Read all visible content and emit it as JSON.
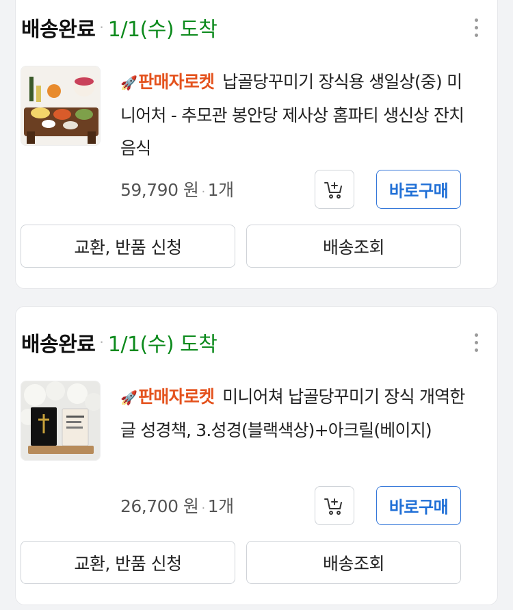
{
  "orders": [
    {
      "status": "배송완료",
      "arrival": "1/1(수) 도착",
      "badge": "판매자로켓",
      "title": "납골당꾸미기 장식용 생일상(중) 미니어처 - 추모관 봉안당 제사상 홈파티 생신상 잔치음식",
      "price": "59,790 원",
      "qty": "1개",
      "buy_label": "바로구매",
      "exchange_label": "교환, 반품 신청",
      "track_label": "배송조회"
    },
    {
      "status": "배송완료",
      "arrival": "1/1(수) 도착",
      "badge": "판매자로켓",
      "title": "미니어쳐 납골당꾸미기 장식 개역한글 성경책, 3.성경(블랙색상)+아크릴(베이지)",
      "price": "26,700 원",
      "qty": "1개",
      "buy_label": "바로구매",
      "exchange_label": "교환, 반품 신청",
      "track_label": "배송조회"
    }
  ],
  "colors": {
    "status_text": "#111111",
    "arrival_green": "#0c8a1c",
    "badge_orange": "#e4521d",
    "buy_blue": "#1f6fd6"
  },
  "icons": {
    "more": "more-vertical-icon",
    "cart": "add-to-cart-icon",
    "rocket": "rocket-icon"
  }
}
